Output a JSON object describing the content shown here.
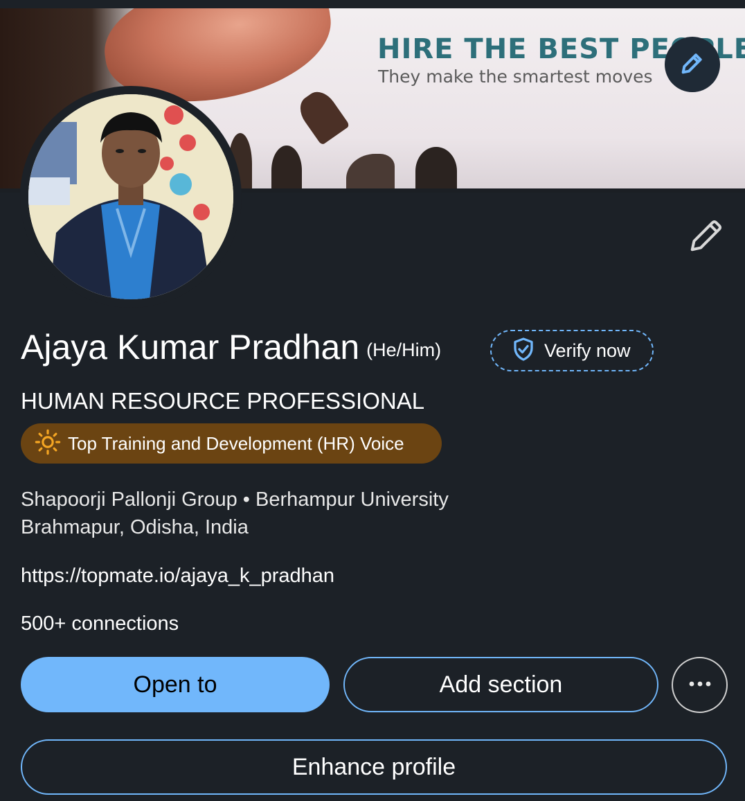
{
  "banner": {
    "title": "HIRE THE BEST PEOPLE",
    "subtitle": "They make the smartest moves"
  },
  "profile": {
    "name": "Ajaya Kumar Pradhan",
    "pronouns": "(He/Him)",
    "verify_label": "Verify now",
    "headline": "HUMAN RESOURCE PROFESSIONAL",
    "voice_badge": "Top Training and Development (HR) Voice",
    "organizations": "Shapoorji Pallonji Group • Berhampur University",
    "location": "Brahmapur, Odisha, India",
    "website": "https://topmate.io/ajaya_k_pradhan",
    "connections": "500+ connections"
  },
  "actions": {
    "open_to": "Open to",
    "add_section": "Add section",
    "enhance_profile": "Enhance profile"
  },
  "icons": {
    "banner_edit": "pencil-icon",
    "intro_edit": "pencil-icon",
    "verify": "shield-check-icon",
    "voice": "sun-icon",
    "more": "ellipsis-icon"
  },
  "colors": {
    "background": "#1c2127",
    "accent": "#71b7fb",
    "voice_badge_bg": "#6b4412",
    "banner_title": "#2d6f7a"
  }
}
